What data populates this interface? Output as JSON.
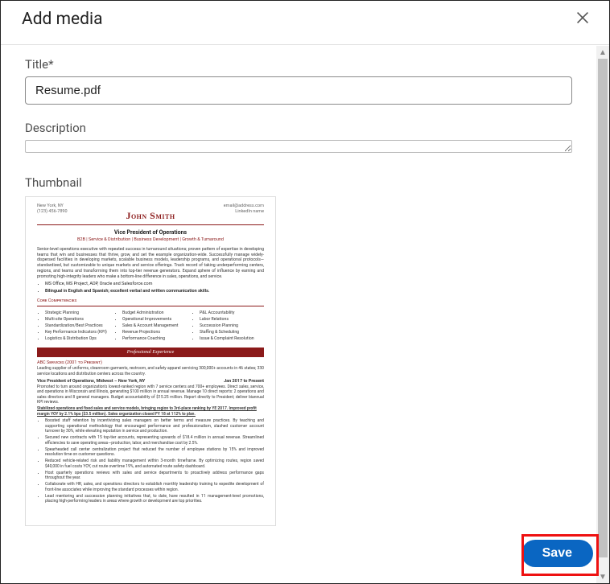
{
  "modal": {
    "title": "Add media",
    "title_field_label": "Title*",
    "title_value": "Resume.pdf",
    "description_label": "Description",
    "description_value": "",
    "thumbnail_label": "Thumbnail",
    "save_label": "Save"
  },
  "resume": {
    "left_contact_1": "New York, NY",
    "left_contact_2": "(123) 456-7890",
    "right_contact_1": "email@address.com",
    "right_contact_2": "LinkedIn name",
    "name": "John Smith",
    "role_title": "Vice President of Operations",
    "tagline": "B2B | Service & Distribution | Business Development | Growth & Turnaround",
    "summary": "Senior-level operations executive with repeated success in turnaround situations; proven pattern of expertise in developing teams that win and businesses that thrive, grow, and set the example organization-wide. Successfully manage widely-dispersed facilities in developing markets, scalable business models, leadership programs, and operational protocols—standardized, but customizable to unique markets and service offerings. Track record of taking underperforming centers, regions, and teams and transforming them into top-tier revenue generators. Expand sphere of influence by earning and promoting high-integrity leaders who make a bottom-line difference in sales, operations, and service.",
    "skill_1": "MS Office, MS Project, ADP, Oracle and Salesforce.com",
    "skill_2": "Bilingual in English and Spanish; excellent verbal and written communication skills.",
    "core_label": "Core Competencies",
    "comp_col1": [
      "Strategic Planning",
      "Multi-site Operations",
      "Standardization/Best Practices",
      "Key Performance Indicators (KPI)",
      "Logistics & Distribution Ops"
    ],
    "comp_col2": [
      "Budget Administration",
      "Operational Improvements",
      "Sales & Account Management",
      "Revenue Projections",
      "Performance Coaching"
    ],
    "comp_col3": [
      "P&L Accountability",
      "Labor Relations",
      "Succession Planning",
      "Staffing & Scheduling",
      "Issue & Complaint Resolution"
    ],
    "prof_exp_label": "Professional Experience",
    "job1_company": "ABC Services (2001 to Present)",
    "job1_company_desc": "Leading supplier of uniforms, cleanroom garments, restroom, and safety apparel servicing 300,000+ accounts in 46 states; 330 service locations and distribution centers across the country.",
    "job1_title": "Vice President of Operations, Midwest – New York, NY",
    "job1_dates": "Jan 2017 to Present",
    "job1_desc": "Promoted to turn around organization's lowest-ranked region with 7 service centers and 700+ employees. Direct sales, service, and operations in Wisconsin and Illinois, generating $100 million in annual revenue. Manage 10 direct reports: 2 operations and sales directors and 8 general managers. Budget accountability of $15.25 million. Report directly to President; deliver biannual KPI reviews.",
    "job1_highlight": "Stabilized operations and fixed sales and service models, bringing region to 3rd-place ranking by YE 2017. Improved profit margin YOY by 2.1% bps ($3.5 million). Sales organization closed FY 18 at 112% to plan.",
    "job1_bullets": [
      "Boosted staff retention by incentivizing sales managers on better terms and measure practices. By teaching and supporting operational methodology that encouraged performance and professionalism, slashed customer account turnover by 30%, while elevating reputation in service and production.",
      "Secured new contracts with 15 top-tier accounts, representing upwards of $18.4 million in annual revenue. Streamlined efficiencies to save operating areas—production, labor, and merchandise cost by 2.5%.",
      "Spearheaded call center centralization project that reduced the number of employee stations by 15% and improved resolution time on customer questions.",
      "Reduced vehicle-related risk and liability management within 3-month timeframe. By optimizing routes, region saved $40,000 in fuel costs YOY, cut route overtime 19%, and automated route safety dashboard.",
      "Host quarterly operations reviews with sales and service departments to proactively address performance gaps throughout the year.",
      "Collaborate with HR, sales, and operations directors to establish monthly leadership training to expedite development of front-line associates while improving the standard processes within region.",
      "Lead mentoring and succession planning initiatives that, to date, have resulted in 11 management-level promotions, placing high-performing leaders in areas where growth or development are top priorities."
    ]
  }
}
